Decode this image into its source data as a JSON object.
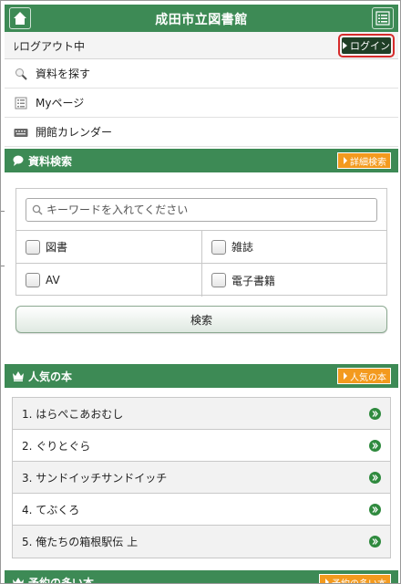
{
  "header": {
    "title": "成田市立図書館",
    "home_icon": "home-icon",
    "menu_icon": "menu-list-icon",
    "color": "#3d8a55"
  },
  "login_bar": {
    "status": "ﾚログアウト中",
    "login_label": "ログイン",
    "highlight_color": "#d62b2b"
  },
  "nav": {
    "items": [
      {
        "label": "資料を探す",
        "icon": "magnifier-icon"
      },
      {
        "label": "Myページ",
        "icon": "mypage-list-icon"
      },
      {
        "label": "開館カレンダー",
        "icon": "keyboard-calendar-icon"
      }
    ]
  },
  "search_section": {
    "title": "資料検索",
    "detail_button": "詳細検索",
    "input_placeholder": "キーワードを入れてください",
    "checkboxes": [
      {
        "label": "図書",
        "checked": false
      },
      {
        "label": "雑誌",
        "checked": false
      },
      {
        "label": "AV",
        "checked": false
      },
      {
        "label": "電子書籍",
        "checked": false
      }
    ],
    "search_button": "検索"
  },
  "popular_section": {
    "title": "人気の本",
    "more_button": "人気の本",
    "items": [
      "1. はらぺこあおむし",
      "2. ぐりとぐら",
      "3. サンドイッチサンドイッチ",
      "4. てぶくろ",
      "5. 俺たちの箱根駅伝 上"
    ]
  },
  "reserved_section": {
    "title": "予約の多い本",
    "more_button": "予約の多い本"
  },
  "colors": {
    "accent_green": "#3d8a55",
    "button_orange": "#f39a1e",
    "chevron_green": "#2f8a3e"
  }
}
